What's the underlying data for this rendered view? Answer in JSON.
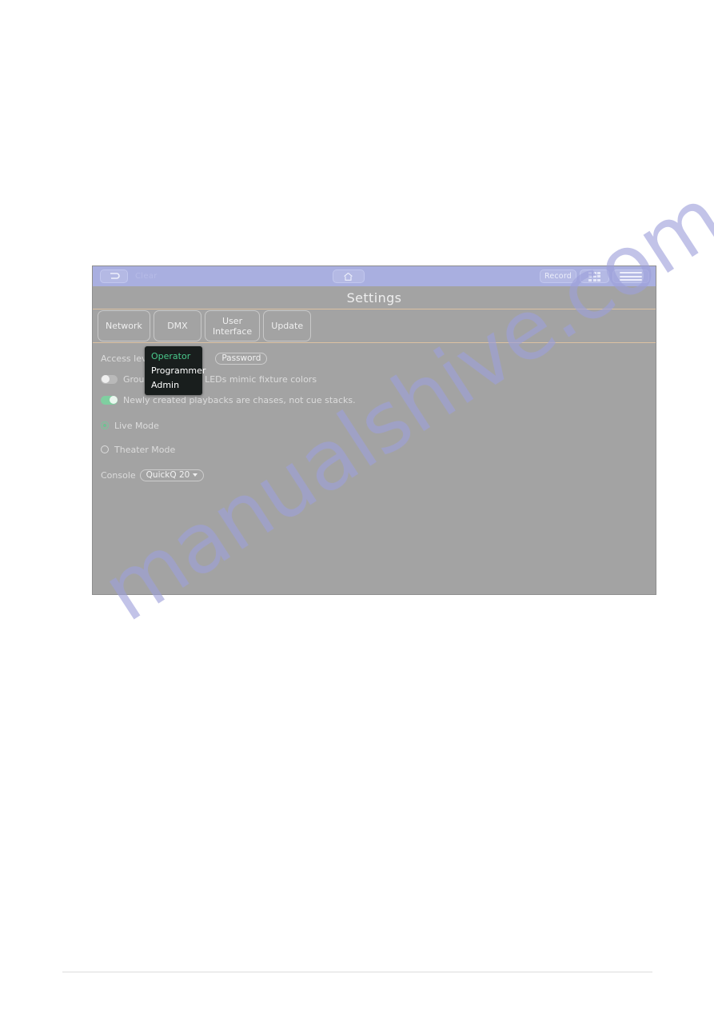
{
  "watermark": {
    "text": "manualshive.com",
    "color": "#9da0db"
  },
  "console": {
    "topbar": {
      "back_icon": "back-arrow-icon",
      "clear_label": "Clear",
      "home_icon": "home-icon",
      "record_label": "Record",
      "grid_icon": "grid-apps-icon",
      "menu_icon": "hamburger-menu-icon"
    },
    "title": "Settings",
    "tabs": [
      {
        "label": "Network"
      },
      {
        "label": "DMX"
      },
      {
        "label": "User\nInterface"
      },
      {
        "label": "Update"
      }
    ],
    "settings": {
      "access_level_label": "Access level",
      "password_button": "Password",
      "toggle_leds_label": "Group and Fixture LEDs mimic fixture colors",
      "toggle_leds_state": "off",
      "toggle_chases_label": "Newly created playbacks are chases, not cue stacks.",
      "toggle_chases_state": "on",
      "radio_live_label": "Live Mode",
      "radio_live_checked": "true",
      "radio_theater_label": "Theater Mode",
      "radio_theater_checked": "false",
      "console_label": "Console",
      "console_value": "QuickQ 20"
    },
    "access_dropdown": {
      "options": [
        {
          "label": "Operator",
          "selected": "true"
        },
        {
          "label": "Programmer",
          "selected": "false"
        },
        {
          "label": "Admin",
          "selected": "false"
        }
      ]
    }
  }
}
